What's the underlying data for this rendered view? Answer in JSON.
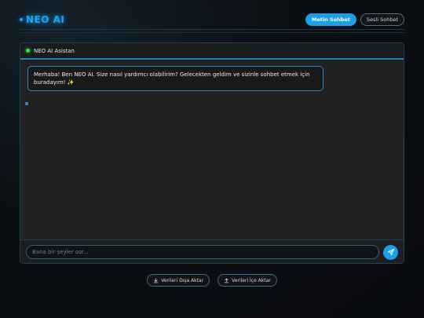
{
  "app": {
    "logo_text": "NEO AI",
    "accent_color": "#1a9fe8"
  },
  "header": {
    "tabs": [
      {
        "label": "Metin Sohbet",
        "active": true
      },
      {
        "label": "Sesli Sohbet",
        "active": false
      }
    ]
  },
  "chat": {
    "assistant_name": "NEO AI Asistan",
    "status_color": "#2ee04a",
    "messages": [
      {
        "sender": "assistant",
        "text": "Merhaba! Ben NEO AI. Size nasıl yardımcı olabilirim? Gelecekten geldim ve sizinle sohbet etmek için buradayım! ✨"
      }
    ],
    "input": {
      "value": "",
      "placeholder": "Bana bir şeyler sor..."
    },
    "send_icon": "send-icon"
  },
  "footer": {
    "export_label": "Verileri Dışa Aktar",
    "export_icon": "download-icon",
    "import_label": "Verileri İçe Aktar",
    "import_icon": "upload-icon"
  }
}
